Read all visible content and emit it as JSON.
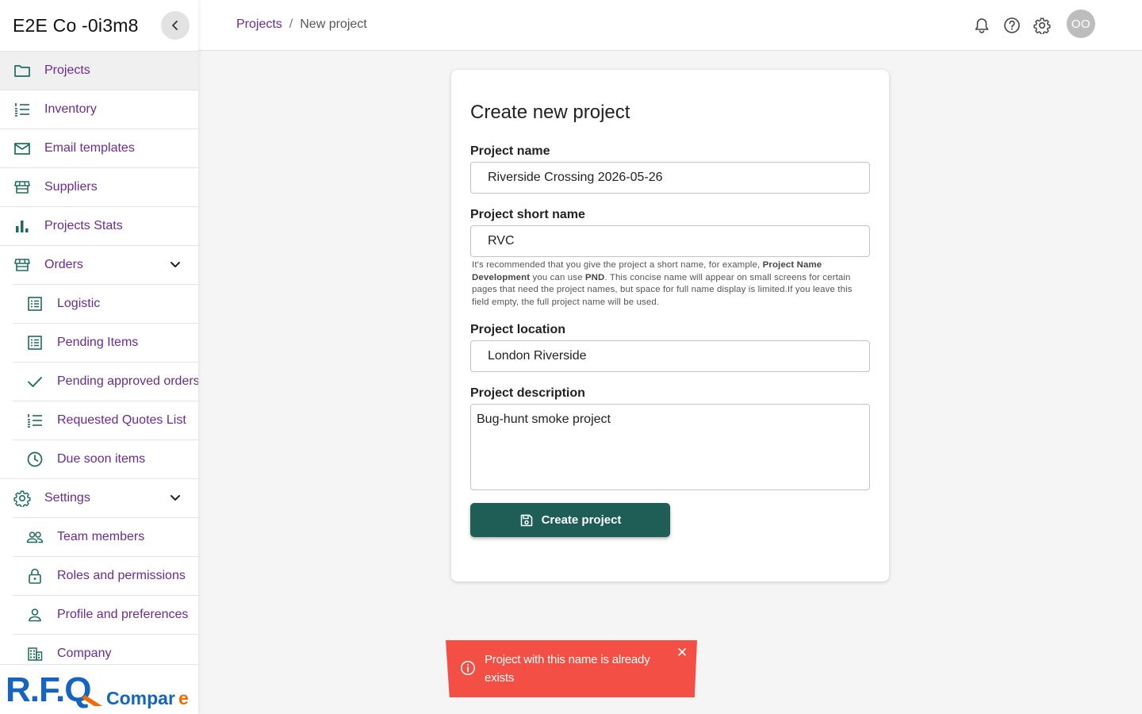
{
  "sidebar": {
    "brand": "E2E Co -0i3m8",
    "items": [
      {
        "label": "Projects"
      },
      {
        "label": "Inventory"
      },
      {
        "label": "Email templates"
      },
      {
        "label": "Suppliers"
      },
      {
        "label": "Projects Stats"
      },
      {
        "label": "Orders"
      },
      {
        "label": "Logistic"
      },
      {
        "label": "Pending Items"
      },
      {
        "label": "Pending approved orders"
      },
      {
        "label": "Requested Quotes List"
      },
      {
        "label": "Due soon items"
      },
      {
        "label": "Settings"
      },
      {
        "label": "Team members"
      },
      {
        "label": "Roles and permissions"
      },
      {
        "label": "Profile and preferences"
      },
      {
        "label": "Company"
      }
    ],
    "logo_text": "R.F.Q Compare"
  },
  "header": {
    "breadcrumb_link": "Projects",
    "breadcrumb_sep": "/",
    "breadcrumb_current": "New project",
    "avatar_initials": "OO"
  },
  "form": {
    "title": "Create new project",
    "name_label": "Project name",
    "name_value": "Riverside Crossing 2026-05-26",
    "short_label": "Project short name",
    "short_value": "RVC",
    "hint_1": "It's recommended that you give the project a short name, for example, ",
    "hint_b1": "Project Name Development",
    "hint_2": " you can use ",
    "hint_b2": "PND",
    "hint_3": ". This concise name will appear on small screens for certain pages that need the project names, but space for full name display is limited.If you leave this field empty, the full project name will be used.",
    "location_label": "Project location",
    "location_value": "London Riverside",
    "desc_label": "Project description",
    "desc_value": "Bug-hunt smoke project",
    "submit_label": "Create project"
  },
  "toast": {
    "message": "Project with this name is already exists",
    "close": "✕"
  },
  "colors": {
    "accent_purple": "#6a2c91",
    "icon_teal": "#1e6b5f",
    "button_green": "#1e5e57",
    "error_red": "#f44f45",
    "logo_blue": "#1565c0",
    "logo_orange": "#ef6c00"
  }
}
